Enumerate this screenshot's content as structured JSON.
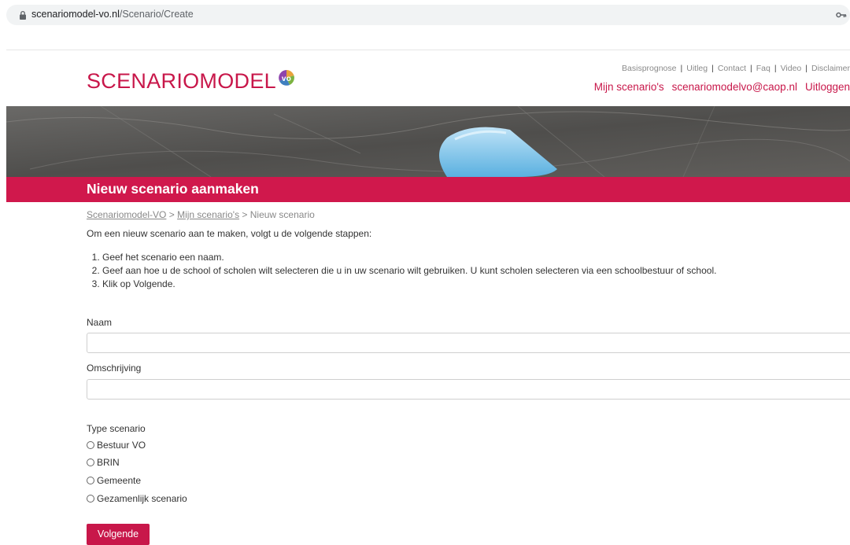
{
  "browser": {
    "url_domain": "scenariomodel-vo.nl",
    "url_path": "/Scenario/Create"
  },
  "header": {
    "logo_text": "SCENARIOMODEL",
    "logo_badge_text": "vo",
    "top_links": [
      "Basisprognose",
      "Uitleg",
      "Contact",
      "Faq",
      "Video",
      "Disclaimer"
    ],
    "main_links": [
      "Mijn scenario's",
      "scenariomodelvo@caop.nl",
      "Uitloggen"
    ]
  },
  "page": {
    "title": "Nieuw scenario aanmaken",
    "breadcrumb": {
      "home": "Scenariomodel-VO",
      "sep1": " > ",
      "parent": "Mijn scenario's",
      "sep2": " > ",
      "current": "Nieuw scenario"
    },
    "intro": "Om een nieuw scenario aan te maken, volgt u de volgende stappen:",
    "steps": [
      "Geef het scenario een naam.",
      "Geef aan hoe u de school of scholen wilt selecteren die u in uw scenario wilt gebruiken. U kunt scholen selecteren via een schoolbestuur of school.",
      "Klik op Volgende."
    ]
  },
  "form": {
    "name_label": "Naam",
    "name_value": "",
    "description_label": "Omschrijving",
    "description_value": "",
    "type_label": "Type scenario",
    "type_options": [
      "Bestuur VO",
      "BRIN",
      "Gemeente",
      "Gezamenlijk scenario"
    ],
    "submit_label": "Volgende"
  },
  "colors": {
    "brand": "#c8174a",
    "title_bar": "#d0184c"
  }
}
